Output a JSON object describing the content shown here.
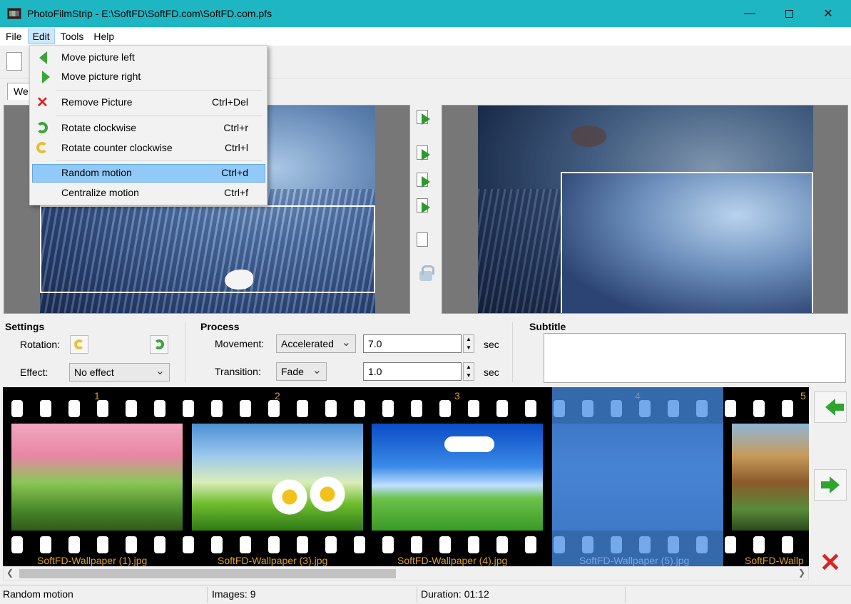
{
  "window": {
    "title": "PhotoFilmStrip - E:\\SoftFD\\SoftFD.com\\SoftFD.com.pfs",
    "minimize": "—",
    "close": "✕"
  },
  "menu": [
    "File",
    "Edit",
    "Tools",
    "Help"
  ],
  "tab": {
    "label": "We"
  },
  "edit_menu": {
    "items": [
      {
        "label": "Move picture left",
        "shortcut": "",
        "icon": "arrow-left-icon"
      },
      {
        "label": "Move picture right",
        "shortcut": "",
        "icon": "arrow-right-icon"
      },
      {
        "label": "Remove Picture",
        "shortcut": "Ctrl+Del",
        "icon": "remove-icon"
      },
      {
        "label": "Rotate clockwise",
        "shortcut": "Ctrl+r",
        "icon": "rotate-clockwise-icon"
      },
      {
        "label": "Rotate counter clockwise",
        "shortcut": "Ctrl+l",
        "icon": "rotate-counter-clockwise-icon"
      },
      {
        "label": "Random motion",
        "shortcut": "Ctrl+d",
        "icon": ""
      },
      {
        "label": "Centralize motion",
        "shortcut": "Ctrl+f",
        "icon": ""
      }
    ],
    "highlighted_index": 5
  },
  "settings": {
    "heading": "Settings",
    "rotation_label": "Rotation:",
    "effect_label": "Effect:",
    "effect_value": "No effect"
  },
  "process": {
    "heading": "Process",
    "movement_label": "Movement:",
    "movement_value": "Accelerated",
    "movement_duration": "7.0",
    "transition_label": "Transition:",
    "transition_value": "Fade",
    "transition_duration": "1.0",
    "unit": "sec"
  },
  "subtitle": {
    "heading": "Subtitle"
  },
  "filmstrip": {
    "frames": [
      {
        "number": "1",
        "caption": "SoftFD-Wallpaper (1).jpg",
        "selected": false
      },
      {
        "number": "2",
        "caption": "SoftFD-Wallpaper (3).jpg",
        "selected": false
      },
      {
        "number": "3",
        "caption": "SoftFD-Wallpaper (4).jpg",
        "selected": false
      },
      {
        "number": "4",
        "caption": "SoftFD-Wallpaper (5).jpg",
        "selected": true
      },
      {
        "number": "5",
        "caption": "SoftFD-Wallp",
        "selected": false
      }
    ]
  },
  "status": {
    "message": "Random motion",
    "images": "Images: 9",
    "duration": "Duration: 01:12"
  },
  "colors": {
    "titlebar": "#1fb6c3",
    "selection": "#91c9f7",
    "frame_caption": "#e0a020"
  }
}
